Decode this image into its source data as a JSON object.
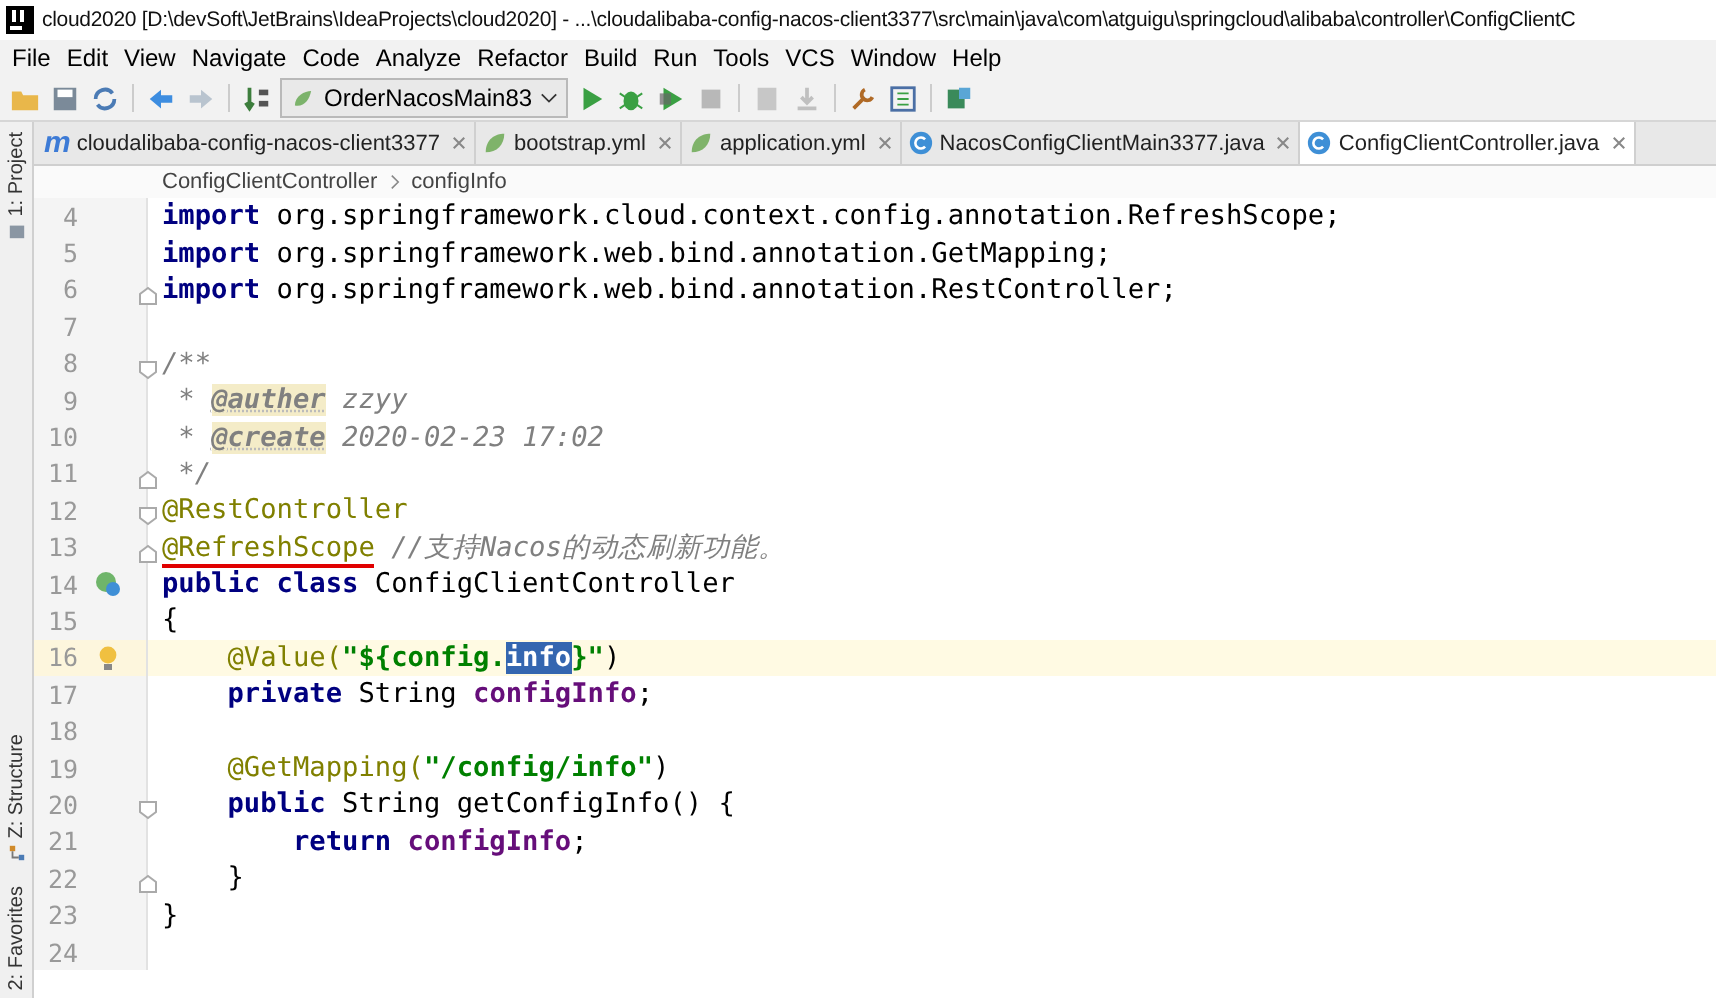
{
  "window": {
    "title": "cloud2020 [D:\\devSoft\\JetBrains\\IdeaProjects\\cloud2020] - ...\\cloudalibaba-config-nacos-client3377\\src\\main\\java\\com\\atguigu\\springcloud\\alibaba\\controller\\ConfigClientC"
  },
  "menu": [
    "File",
    "Edit",
    "View",
    "Navigate",
    "Code",
    "Analyze",
    "Refactor",
    "Build",
    "Run",
    "Tools",
    "VCS",
    "Window",
    "Help"
  ],
  "toolbar": {
    "run_config": "OrderNacosMain83"
  },
  "tool_strip": [
    {
      "label": "1: Project",
      "kind": "project"
    },
    {
      "label": "Z: Structure",
      "kind": "structure"
    },
    {
      "label": "2: Favorites",
      "kind": "favorites"
    }
  ],
  "tabs": [
    {
      "label": "cloudalibaba-config-nacos-client3377",
      "kind": "maven",
      "badge": "m",
      "selected": false
    },
    {
      "label": "bootstrap.yml",
      "kind": "yml",
      "selected": false
    },
    {
      "label": "application.yml",
      "kind": "yml",
      "selected": false
    },
    {
      "label": "NacosConfigClientMain3377.java",
      "kind": "class",
      "selected": false
    },
    {
      "label": "ConfigClientController.java",
      "kind": "class",
      "selected": true
    }
  ],
  "breadcrumb": [
    "ConfigClientController",
    "configInfo"
  ],
  "lines": [
    {
      "number": "4",
      "tokens": [
        {
          "t": "import",
          "kind": "kw"
        },
        {
          "t": " org.springframework.cloud.context.config.annotation.RefreshScope;",
          "kind": "plain"
        }
      ]
    },
    {
      "number": "5",
      "tokens": [
        {
          "t": "import",
          "kind": "kw"
        },
        {
          "t": " org.springframework.web.bind.annotation.GetMapping;",
          "kind": "plain"
        }
      ]
    },
    {
      "number": "6",
      "fold_end": true,
      "tokens": [
        {
          "t": "import",
          "kind": "kw"
        },
        {
          "t": " org.springframework.web.bind.annotation.RestController;",
          "kind": "plain"
        }
      ]
    },
    {
      "number": "7"
    },
    {
      "number": "8",
      "fold_start": true,
      "tokens": [
        {
          "t": "/**",
          "kind": "comment"
        }
      ]
    },
    {
      "number": "9",
      "tokens": [
        {
          "t": " * ",
          "kind": "comment"
        },
        {
          "t": "@auther",
          "kind": "doctag"
        },
        {
          "t": " zzyy",
          "kind": "comment"
        }
      ]
    },
    {
      "number": "10",
      "tokens": [
        {
          "t": " * ",
          "kind": "comment"
        },
        {
          "t": "@create",
          "kind": "doctag"
        },
        {
          "t": " 2020-02-23 17:02",
          "kind": "comment"
        }
      ]
    },
    {
      "number": "11",
      "fold_end": true,
      "tokens": [
        {
          "t": " */",
          "kind": "comment"
        }
      ]
    },
    {
      "number": "12",
      "fold_start": true,
      "tokens": [
        {
          "t": "@RestController",
          "kind": "ann"
        }
      ]
    },
    {
      "number": "13",
      "fold_end": true,
      "tokens": [
        {
          "t": "@RefreshScope",
          "kind": "ann",
          "underlined": true
        },
        {
          "t": " //支持Nacos的动态刷新功能。",
          "kind": "comment"
        }
      ]
    },
    {
      "number": "14",
      "gutter_icon": {
        "kind": "class"
      },
      "tokens": [
        {
          "t": "public class",
          "kind": "kw"
        },
        {
          "t": " ConfigClientController",
          "kind": "plain"
        }
      ]
    },
    {
      "number": "15",
      "tokens": [
        {
          "t": "{",
          "kind": "plain"
        }
      ]
    },
    {
      "number": "16",
      "current": true,
      "gutter_icon": {
        "kind": "bulb"
      },
      "tokens": [
        {
          "t": "    @Value(",
          "kind": "ann"
        },
        {
          "t": "\"${config.",
          "kind": "str"
        },
        {
          "t": "info",
          "kind": "str",
          "selected": true
        },
        {
          "t": "}\"",
          "kind": "str"
        },
        {
          "t": ")",
          "kind": "plain"
        }
      ]
    },
    {
      "number": "17",
      "tokens": [
        {
          "t": "    private",
          "kind": "kw"
        },
        {
          "t": " String ",
          "kind": "plain"
        },
        {
          "t": "configInfo",
          "kind": "field"
        },
        {
          "t": ";",
          "kind": "plain"
        }
      ]
    },
    {
      "number": "18"
    },
    {
      "number": "19",
      "tokens": [
        {
          "t": "    @GetMapping(",
          "kind": "ann"
        },
        {
          "t": "\"/config/info\"",
          "kind": "str"
        },
        {
          "t": ")",
          "kind": "plain"
        }
      ]
    },
    {
      "number": "20",
      "fold_start": true,
      "tokens": [
        {
          "t": "    public",
          "kind": "kw"
        },
        {
          "t": " String getConfigInfo() {",
          "kind": "plain"
        }
      ]
    },
    {
      "number": "21",
      "tokens": [
        {
          "t": "        return",
          "kind": "kw"
        },
        {
          "t": " configInfo",
          "kind": "field"
        },
        {
          "t": ";",
          "kind": "plain"
        }
      ]
    },
    {
      "number": "22",
      "fold_end": true,
      "tokens": [
        {
          "t": "    }",
          "kind": "plain"
        }
      ]
    },
    {
      "number": "23",
      "tokens": [
        {
          "t": "}",
          "kind": "plain"
        }
      ]
    },
    {
      "number": "24"
    }
  ]
}
